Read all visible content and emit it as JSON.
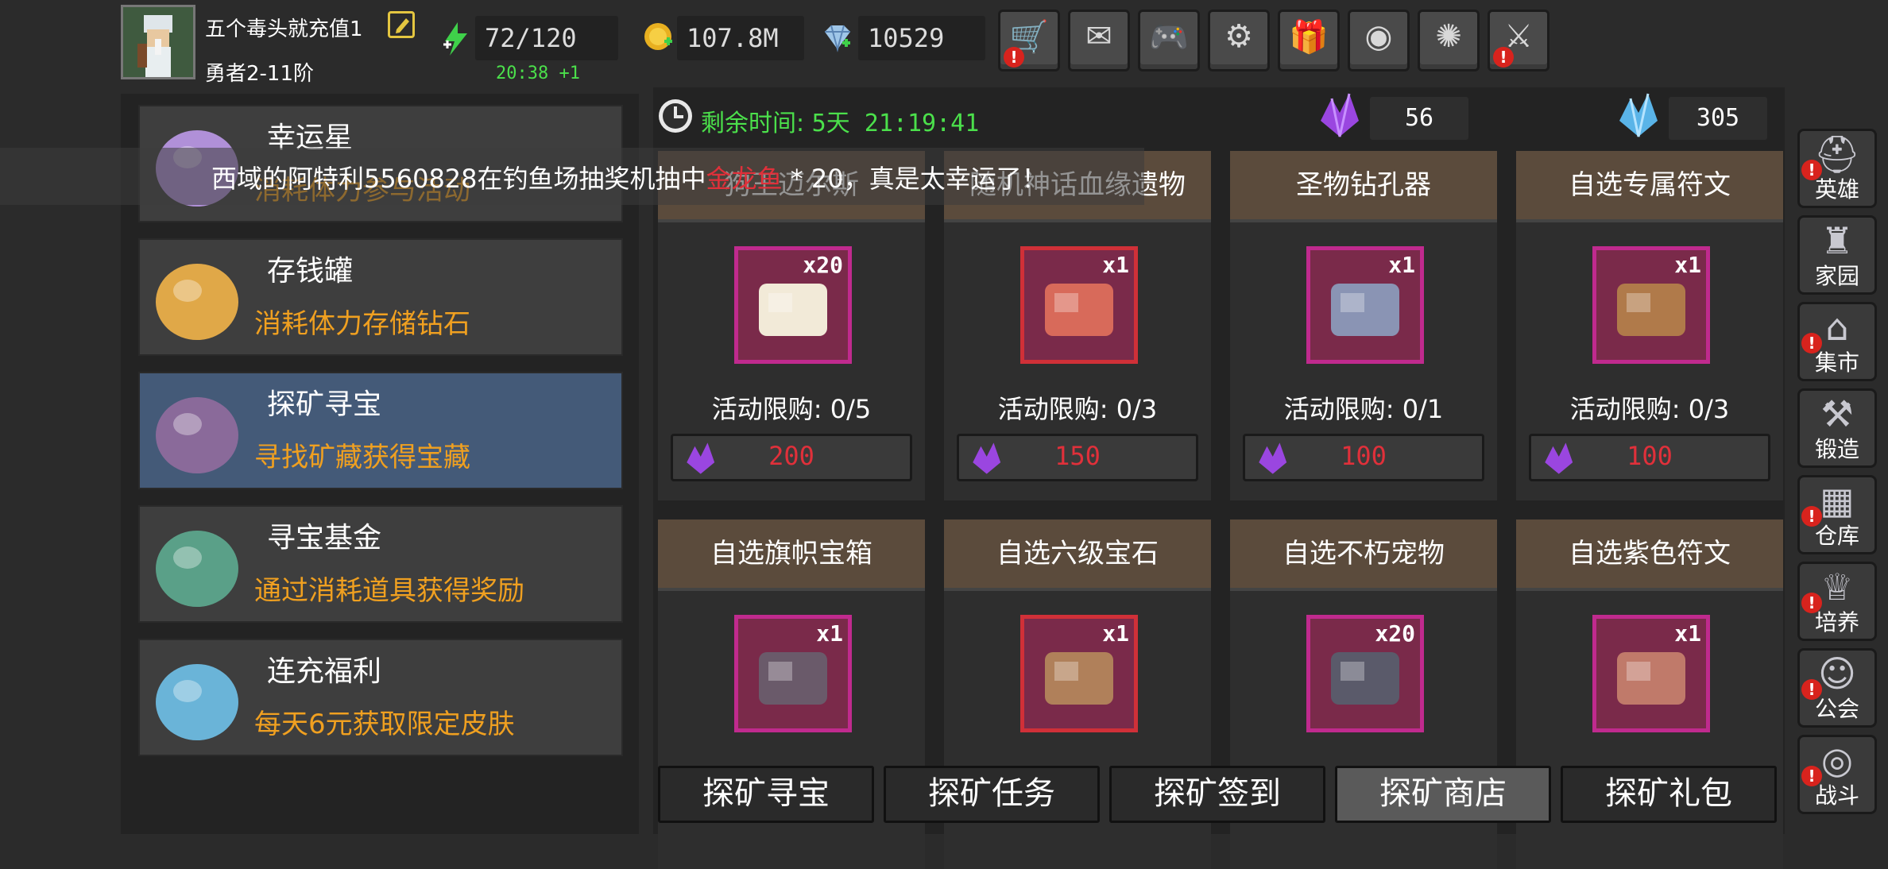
{
  "player": {
    "name": "五个毒头就充值1",
    "rank": "勇者2-11阶"
  },
  "resources": {
    "stamina": "72/120",
    "stamina_regen": "20:38 +1",
    "gold": "107.8M",
    "diamonds": "10529"
  },
  "toolbar": {
    "buttons": [
      {
        "icon": "shop-cart-icon",
        "badge": "!"
      },
      {
        "icon": "mail-icon",
        "badge": ""
      },
      {
        "icon": "gamepad-icon",
        "badge": ""
      },
      {
        "icon": "settings-gear-icon",
        "badge": ""
      },
      {
        "icon": "gift-icon",
        "badge": ""
      },
      {
        "icon": "color-wheel-icon",
        "badge": ""
      },
      {
        "icon": "fireworks-icon",
        "badge": ""
      },
      {
        "icon": "crossed-swords-icon",
        "badge": "!"
      }
    ]
  },
  "sidebar": {
    "items": [
      {
        "title": "幸运星",
        "desc": "消耗体力参与活动",
        "icon": "lucky-star-icon",
        "active": false
      },
      {
        "title": "存钱罐",
        "desc": "消耗体力存储钻石",
        "icon": "piggy-bank-icon",
        "active": false
      },
      {
        "title": "探矿寻宝",
        "desc": "寻找矿藏获得宝藏",
        "icon": "treasure-chest-icon",
        "active": true
      },
      {
        "title": "寻宝基金",
        "desc": "通过消耗道具获得奖励",
        "icon": "money-bag-icon",
        "active": false
      },
      {
        "title": "连充福利",
        "desc": "每天6元获取限定皮肤",
        "icon": "crystal-cube-icon",
        "active": false
      }
    ]
  },
  "marquee": {
    "prefix": "西域的阿特利5560828在钓鱼场抽奖机抽中",
    "highlight": "金龙鱼",
    "suffix": " * 20，真是太幸运了！"
  },
  "shop": {
    "timer_label": "剩余时间:",
    "timer_value": "5天 21:19:41",
    "purple_gems": "56",
    "blue_gems": "305",
    "items": [
      {
        "name": "狗王迈尔斯",
        "qty": "x20",
        "limit": "活动限购: 0/5",
        "price": "200",
        "frame": "#c02a8e",
        "icon": "white-dog-icon"
      },
      {
        "name": "随机神话血缘遗物",
        "qty": "x1",
        "limit": "活动限购: 0/3",
        "price": "150",
        "frame": "#d03038",
        "icon": "relic-chest-icon"
      },
      {
        "name": "圣物钻孔器",
        "qty": "x1",
        "limit": "活动限购: 0/1",
        "price": "100",
        "frame": "#c02a8e",
        "icon": "drill-icon"
      },
      {
        "name": "自选专属符文",
        "qty": "x1",
        "limit": "活动限购: 0/3",
        "price": "100",
        "frame": "#c02a8e",
        "icon": "rune-chest-icon"
      },
      {
        "name": "自选旗帜宝箱",
        "qty": "x1",
        "limit": "",
        "price": "",
        "frame": "#c02a8e",
        "icon": "flag-chest-icon"
      },
      {
        "name": "自选六级宝石",
        "qty": "x1",
        "limit": "",
        "price": "",
        "frame": "#d03038",
        "icon": "gem-chest-icon"
      },
      {
        "name": "自选不朽宠物",
        "qty": "x20",
        "limit": "",
        "price": "",
        "frame": "#c02a8e",
        "icon": "pet-egg-chest-icon"
      },
      {
        "name": "自选紫色符文",
        "qty": "x1",
        "limit": "",
        "price": "",
        "frame": "#c02a8e",
        "icon": "purple-rune-chest-icon"
      }
    ]
  },
  "tabs": [
    {
      "label": "探矿寻宝",
      "active": false
    },
    {
      "label": "探矿任务",
      "active": false
    },
    {
      "label": "探矿签到",
      "active": false
    },
    {
      "label": "探矿商店",
      "active": true
    },
    {
      "label": "探矿礼包",
      "active": false
    }
  ],
  "nav": [
    {
      "label": "英雄",
      "icon": "helmet-icon",
      "badge": "!"
    },
    {
      "label": "家园",
      "icon": "castle-icon",
      "badge": ""
    },
    {
      "label": "集市",
      "icon": "market-icon",
      "badge": "!"
    },
    {
      "label": "锻造",
      "icon": "anvil-icon",
      "badge": ""
    },
    {
      "label": "仓库",
      "icon": "warehouse-icon",
      "badge": "!"
    },
    {
      "label": "培养",
      "icon": "trophy-icon",
      "badge": "!"
    },
    {
      "label": "公会",
      "icon": "guild-icon",
      "badge": "!"
    },
    {
      "label": "战斗",
      "icon": "portal-icon",
      "badge": "!"
    }
  ]
}
